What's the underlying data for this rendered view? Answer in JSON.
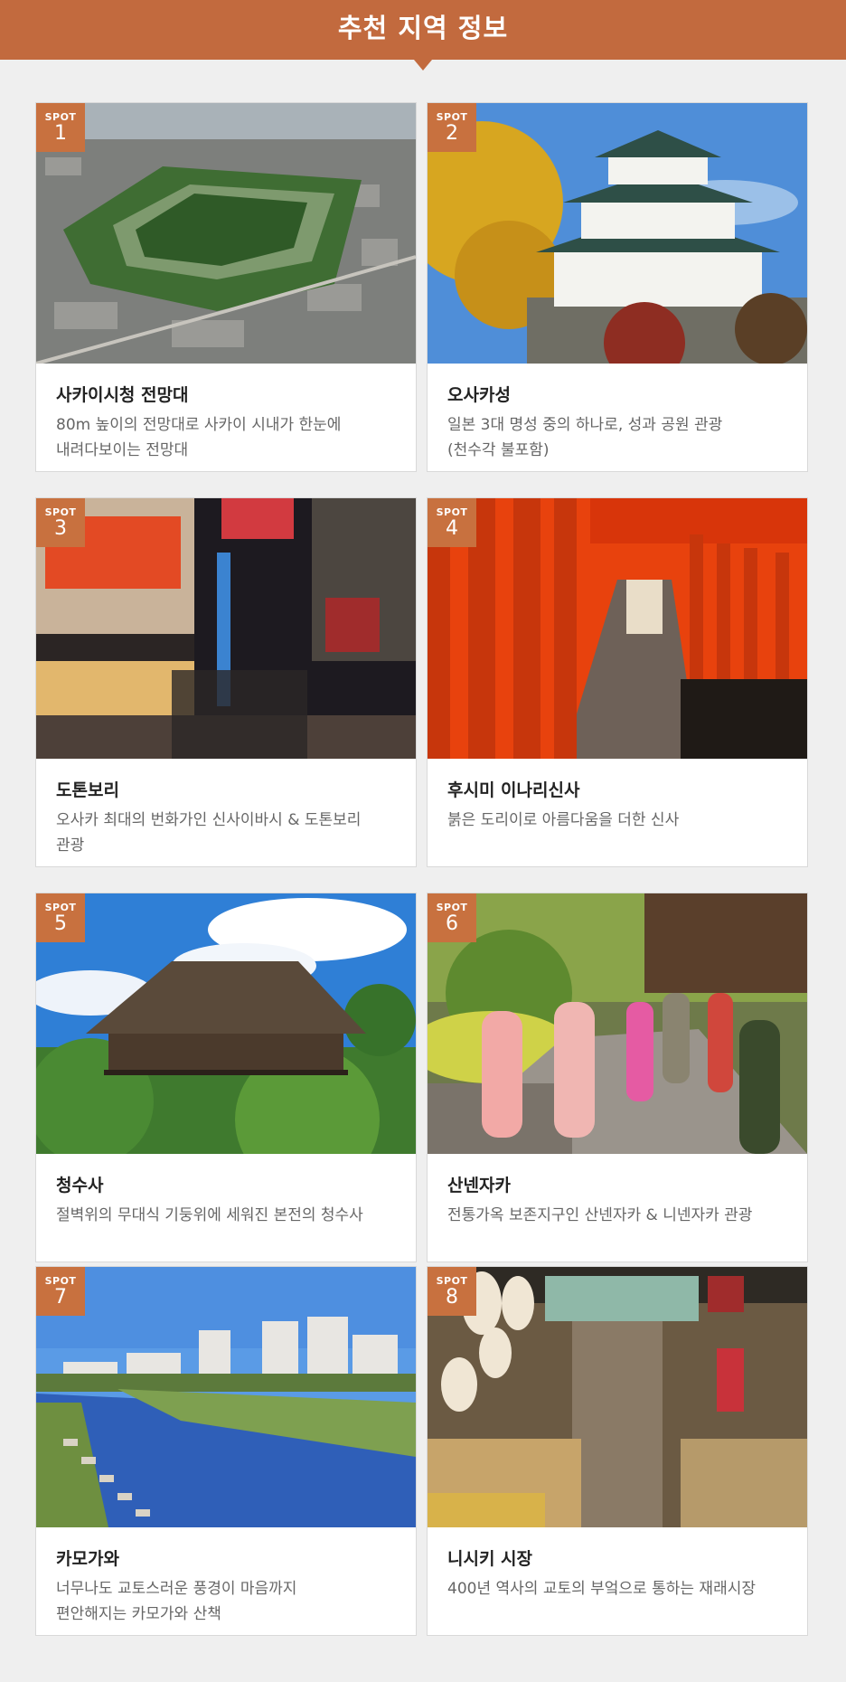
{
  "header": {
    "title": "추천 지역 정보"
  },
  "spot_label": "SPOT",
  "spots": [
    {
      "num": "1",
      "name": "사카이시청 전망대",
      "desc1": "80m 높이의 전망대로 사카이 시내가 한눈에",
      "desc2": "내려다보이는 전망대"
    },
    {
      "num": "2",
      "name": "오사카성",
      "desc1": "일본 3대 명성 중의 하나로, 성과 공원 관광",
      "desc2": "(천수각 불포함)"
    },
    {
      "num": "3",
      "name": "도톤보리",
      "desc1": "오사카 최대의 번화가인 신사이바시 & 도톤보리",
      "desc2": "관광"
    },
    {
      "num": "4",
      "name": "후시미 이나리신사",
      "desc1": "붉은 도리이로 아름다움을 더한 신사",
      "desc2": ""
    },
    {
      "num": "5",
      "name": "청수사",
      "desc1": "절벽위의 무대식 기둥위에 세워진 본전의 청수사",
      "desc2": ""
    },
    {
      "num": "6",
      "name": "산넨자카",
      "desc1": "전통가옥 보존지구인 산넨자카 & 니넨자카 관광",
      "desc2": ""
    },
    {
      "num": "7",
      "name": "카모가와",
      "desc1": "너무나도 교토스러운 풍경이 마음까지",
      "desc2": "편안해지는 카모가와 산책"
    },
    {
      "num": "8",
      "name": "니시키 시장",
      "desc1": "400년 역사의 교토의 부엌으로 통하는 재래시장",
      "desc2": ""
    }
  ],
  "colors": {
    "header": "#c26a3e",
    "badge": "#c8713f"
  }
}
